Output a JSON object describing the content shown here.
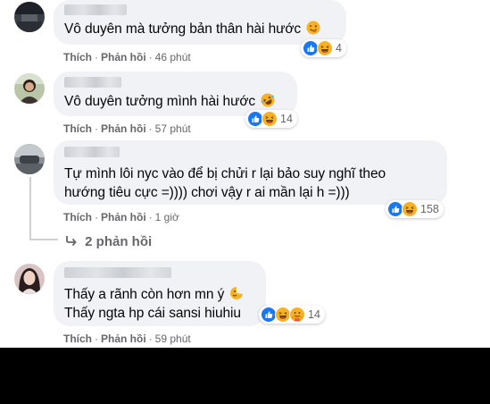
{
  "comments": [
    {
      "text_lines": [
        "Vô duyên mà tưởng bản thân hài hước"
      ],
      "emoji": "wink-tongue-emoji",
      "reactions": {
        "icons": [
          "like-icon",
          "haha-icon"
        ],
        "count": "4"
      },
      "actions": {
        "like": "Thích",
        "reply": "Phản hồi",
        "time": "46 phút"
      }
    },
    {
      "text_lines": [
        "Vô duyên tưởng mình hài hước"
      ],
      "emoji": "rofl-emoji",
      "reactions": {
        "icons": [
          "like-icon",
          "haha-icon"
        ],
        "count": "14"
      },
      "actions": {
        "like": "Thích",
        "reply": "Phản hồi",
        "time": "57 phút"
      }
    },
    {
      "text_lines": [
        "Tự mình lôi nyc vào để bị chửi r lại bảo suy nghĩ theo",
        "hướng tiêu cực =)))) chơi vậy r ai mần lại h =)))"
      ],
      "reactions": {
        "icons": [
          "like-icon",
          "haha-icon"
        ],
        "count": "158"
      },
      "actions": {
        "like": "Thích",
        "reply": "Phản hồi",
        "time": "1 giờ"
      },
      "replies_label": "2 phản hồi"
    },
    {
      "text_lines": [
        "Thấy a rãnh còn hơn mn ý",
        "Thấy ngta hp cái sansi hiuhiu"
      ],
      "emoji": "sparkle-face-emoji",
      "reactions": {
        "icons": [
          "like-icon",
          "haha-icon",
          "care-icon"
        ],
        "count": "14"
      },
      "actions": {
        "like": "Thích",
        "reply": "Phản hồi",
        "time": "59 phút"
      }
    }
  ],
  "colors": {
    "bubble": "#f0f2f5",
    "secondary_text": "#65676b",
    "like_blue": "#1877f2",
    "haha_yellow": "#f7b125"
  }
}
